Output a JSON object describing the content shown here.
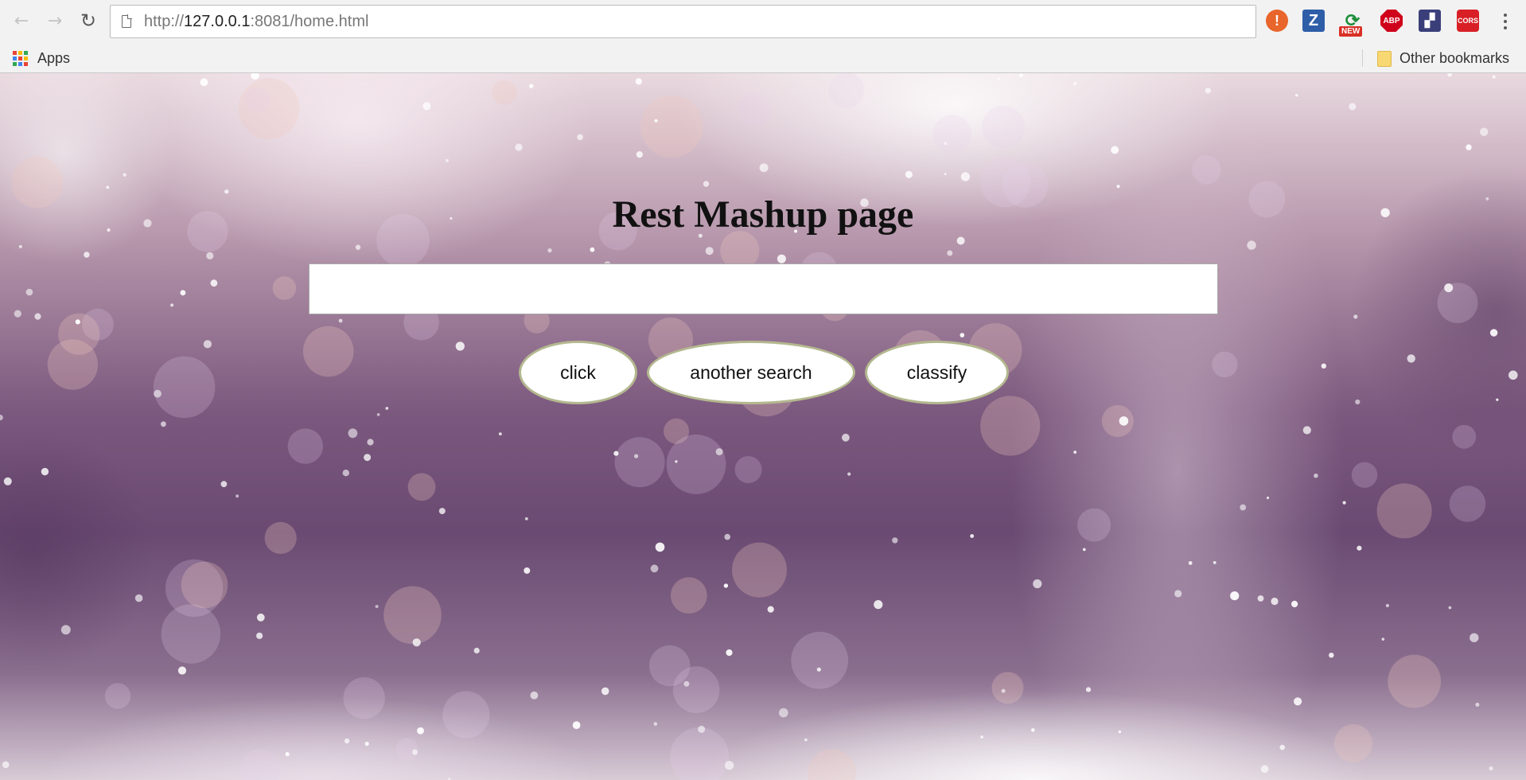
{
  "browser": {
    "url_scheme": "http://",
    "url_host": "127.0.0.1",
    "url_rest": ":8081/home.html",
    "extensions": [
      {
        "name": "alert-extension-icon",
        "glyph": "!"
      },
      {
        "name": "z-extension-icon",
        "glyph": "Z"
      },
      {
        "name": "refresh-extension-icon",
        "glyph": "⟳",
        "badge": "NEW"
      },
      {
        "name": "abp-extension-icon",
        "glyph": "ABP"
      },
      {
        "name": "puzzle-extension-icon",
        "glyph": "▞"
      },
      {
        "name": "cors-extension-icon",
        "glyph": "CORS"
      }
    ]
  },
  "bookmarks": {
    "apps_label": "Apps",
    "other_label": "Other bookmarks"
  },
  "page": {
    "title": "Rest Mashup page",
    "search_value": "",
    "buttons": {
      "click": "click",
      "another_search": "another search",
      "classify": "classify"
    },
    "button_border_color": "#b4b88f"
  }
}
